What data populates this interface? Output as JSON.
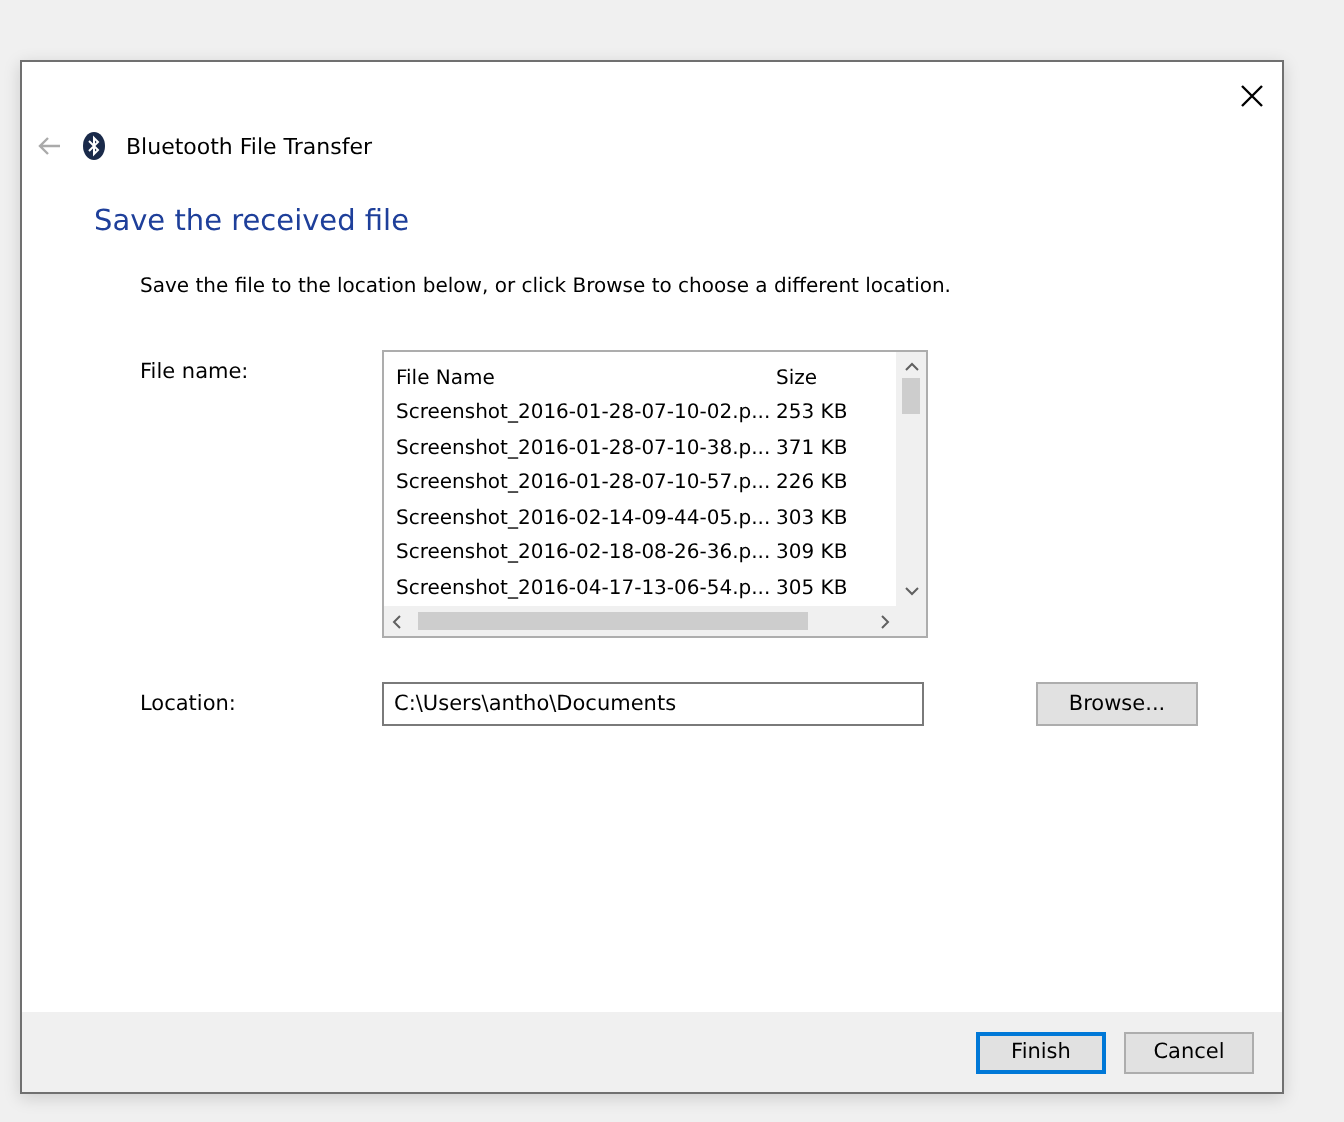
{
  "window": {
    "title": "Bluetooth File Transfer"
  },
  "heading": "Save the received file",
  "instruction": "Save the file to the location below, or click Browse to choose a different location.",
  "file_list": {
    "label": "File name:",
    "columns": [
      "File Name",
      "Size"
    ],
    "rows": [
      {
        "name": "Screenshot_2016-01-28-07-10-02.p...",
        "size": "253 KB"
      },
      {
        "name": "Screenshot_2016-01-28-07-10-38.p...",
        "size": "371 KB"
      },
      {
        "name": "Screenshot_2016-01-28-07-10-57.p...",
        "size": "226 KB"
      },
      {
        "name": "Screenshot_2016-02-14-09-44-05.p...",
        "size": "303 KB"
      },
      {
        "name": "Screenshot_2016-02-18-08-26-36.p...",
        "size": "309 KB"
      },
      {
        "name": "Screenshot_2016-04-17-13-06-54.p...",
        "size": "305 KB"
      }
    ]
  },
  "location": {
    "label": "Location:",
    "value": "C:\\Users\\antho\\Documents",
    "browse": "Browse..."
  },
  "buttons": [
    {
      "label": "Finish",
      "default": true
    },
    {
      "label": "Cancel",
      "default": false
    }
  ]
}
